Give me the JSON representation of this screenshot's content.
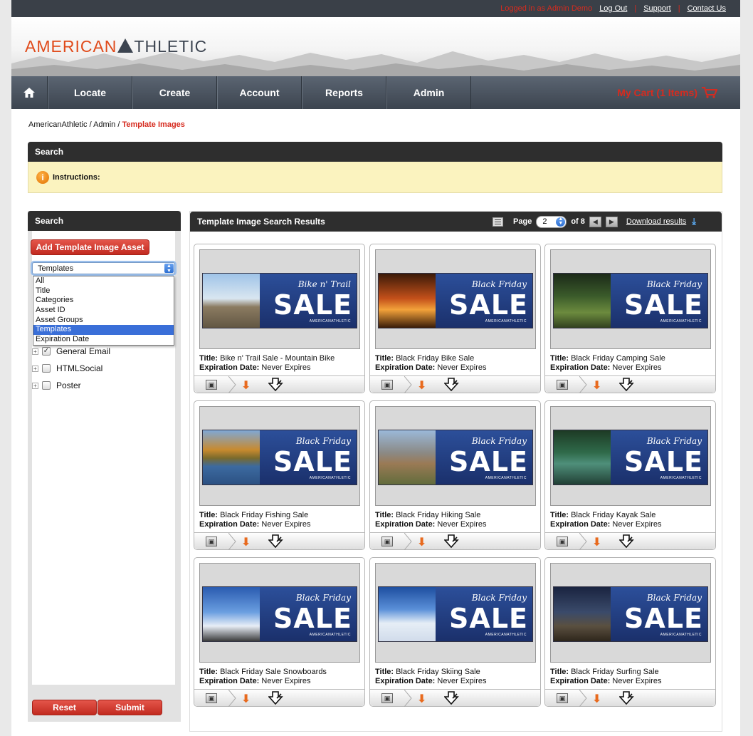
{
  "topbar": {
    "logged_in": "Logged in as Admin Demo",
    "logout": "Log Out",
    "support": "Support",
    "contact": "Contact Us",
    "separator": "|"
  },
  "brand": {
    "left": "AMERICAN",
    "right": "THLETIC"
  },
  "nav": {
    "home_icon": "home-icon",
    "items": [
      "Locate",
      "Create",
      "Account",
      "Reports",
      "Admin"
    ],
    "cart": "My Cart (1 Items)"
  },
  "breadcrumb": {
    "part1": "AmericanAthletic / Admin / ",
    "current": "Template Images"
  },
  "search_bar": {
    "title": "Search",
    "instructions": "Instructions:"
  },
  "sidebar": {
    "title": "Search",
    "add_button": "Add Template Image Asset",
    "select_value": "Templates",
    "options": [
      "All",
      "Title",
      "Categories",
      "Asset ID",
      "Asset Groups",
      "Templates",
      "Expiration Date"
    ],
    "tree": [
      {
        "label": "General Email",
        "checked": true
      },
      {
        "label": "HTMLSocial",
        "checked": false
      },
      {
        "label": "Poster",
        "checked": false
      }
    ],
    "reset": "Reset",
    "submit": "Submit"
  },
  "results": {
    "title": "Template Image Search Results",
    "page_label": "Page",
    "page_value": "2",
    "of_label": "of 8",
    "download": "Download results",
    "title_label": "Title:",
    "exp_label": "Expiration Date:",
    "cards": [
      {
        "title": "Bike n' Trail Sale - Mountain Bike",
        "exp": "Never Expires",
        "promo": "Bike n' Trail",
        "sale": "SALE",
        "brand": "AMERICANATHLETIC",
        "scene": "mtb"
      },
      {
        "title": "Black Friday Bike Sale",
        "exp": "Never Expires",
        "promo": "Black Friday",
        "sale": "SALE",
        "brand": "AMERICANATHLETIC",
        "scene": "sunset"
      },
      {
        "title": "Black Friday Camping Sale",
        "exp": "Never Expires",
        "promo": "Black Friday",
        "sale": "SALE",
        "brand": "AMERICANATHLETIC",
        "scene": "camp"
      },
      {
        "title": "Black Friday Fishing Sale",
        "exp": "Never Expires",
        "promo": "Black Friday",
        "sale": "SALE",
        "brand": "AMERICANATHLETIC",
        "scene": "lake"
      },
      {
        "title": "Black Friday Hiking Sale",
        "exp": "Never Expires",
        "promo": "Black Friday",
        "sale": "SALE",
        "brand": "AMERICANATHLETIC",
        "scene": "hike"
      },
      {
        "title": "Black Friday Kayak Sale",
        "exp": "Never Expires",
        "promo": "Black Friday",
        "sale": "SALE",
        "brand": "AMERICANATHLETIC",
        "scene": "kayak"
      },
      {
        "title": "Black Friday Sale Snowboards",
        "exp": "Never Expires",
        "promo": "Black Friday",
        "sale": "SALE",
        "brand": "AMERICANATHLETIC",
        "scene": "snowboard"
      },
      {
        "title": "Black Friday Skiing Sale",
        "exp": "Never Expires",
        "promo": "Black Friday",
        "sale": "SALE",
        "brand": "AMERICANATHLETIC",
        "scene": "ski"
      },
      {
        "title": "Black Friday Surfing Sale",
        "exp": "Never Expires",
        "promo": "Black Friday",
        "sale": "SALE",
        "brand": "AMERICANATHLETIC",
        "scene": "surf"
      }
    ]
  },
  "colors": {
    "accent_red": "#d62b1f",
    "orange": "#e04a1a",
    "nav": "#4a535e"
  }
}
